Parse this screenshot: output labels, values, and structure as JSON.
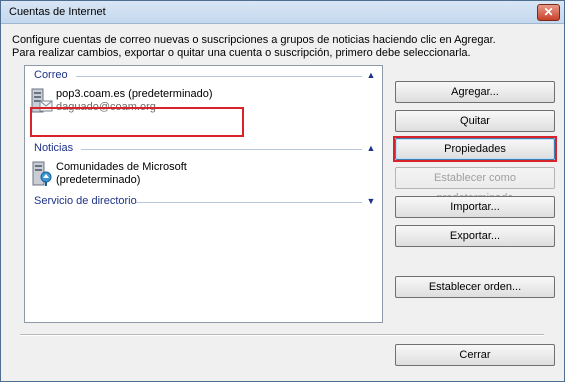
{
  "window": {
    "title": "Cuentas de Internet",
    "close_glyph": "✕"
  },
  "instructions": {
    "line1": "Configure cuentas de correo nuevas o suscripciones a grupos de noticias haciendo clic en Agregar.",
    "line2": "Para realizar cambios, exportar o quitar una cuenta o suscripción, primero debe seleccionarla."
  },
  "accounts": {
    "groups": [
      {
        "label": "Correo",
        "expanded": true,
        "chevron": "▲",
        "items": [
          {
            "name": "pop3.coam.es (predeterminado)",
            "detail": "daguado@coam.org",
            "icon": "mail-server-icon",
            "selected": true
          }
        ]
      },
      {
        "label": "Noticias",
        "expanded": true,
        "chevron": "▲",
        "items": [
          {
            "name": "Comunidades de Microsoft",
            "detail": "(predeterminado)",
            "icon": "news-server-icon",
            "selected": false
          }
        ]
      },
      {
        "label": "Servicio de directorio",
        "expanded": false,
        "chevron": "▼",
        "items": []
      }
    ]
  },
  "buttons": {
    "add": "Agregar...",
    "remove": "Quitar",
    "properties": "Propiedades",
    "set_default": "Establecer como predeterminada",
    "import": "Importar...",
    "export": "Exportar...",
    "set_order": "Establecer orden...",
    "close": "Cerrar"
  },
  "colors": {
    "highlight_frame": "#d9232b",
    "group_header": "#1e3287",
    "title_bar": "#c4d8ee"
  }
}
